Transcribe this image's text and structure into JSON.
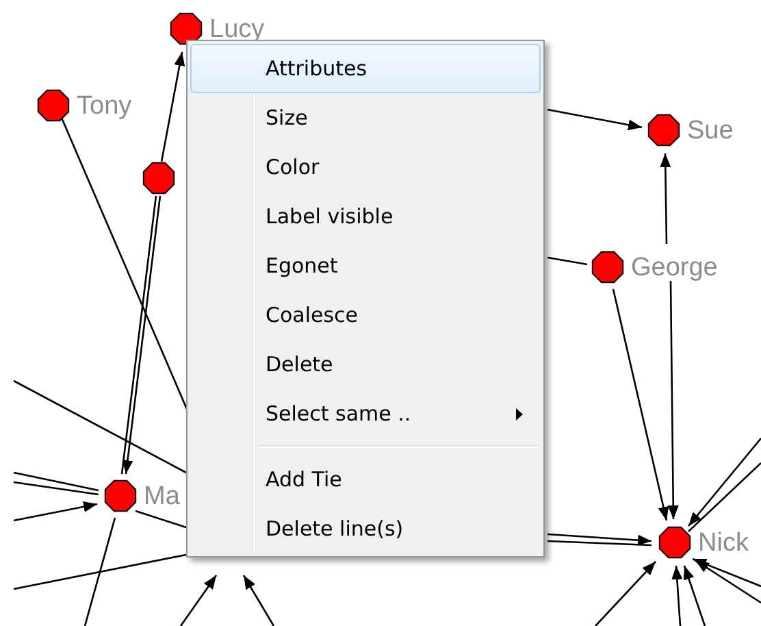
{
  "graph": {
    "node_labels": [
      "Lucy",
      "Tony",
      "Sue",
      "George",
      "Ma",
      "Nick"
    ]
  },
  "context_menu": {
    "items": [
      {
        "kind": "item",
        "label": "Attributes",
        "selected": true,
        "submenu": false
      },
      {
        "kind": "item",
        "label": "Size",
        "selected": false,
        "submenu": false
      },
      {
        "kind": "item",
        "label": "Color",
        "selected": false,
        "submenu": false
      },
      {
        "kind": "item",
        "label": "Label visible",
        "selected": false,
        "submenu": false
      },
      {
        "kind": "item",
        "label": "Egonet",
        "selected": false,
        "submenu": false
      },
      {
        "kind": "item",
        "label": "Coalesce",
        "selected": false,
        "submenu": false
      },
      {
        "kind": "item",
        "label": "Delete",
        "selected": false,
        "submenu": false
      },
      {
        "kind": "item",
        "label": "Select same ..",
        "selected": false,
        "submenu": true
      },
      {
        "kind": "separator"
      },
      {
        "kind": "item",
        "label": "Add Tie",
        "selected": false,
        "submenu": false
      },
      {
        "kind": "item",
        "label": "Delete line(s)",
        "selected": false,
        "submenu": false
      }
    ]
  }
}
